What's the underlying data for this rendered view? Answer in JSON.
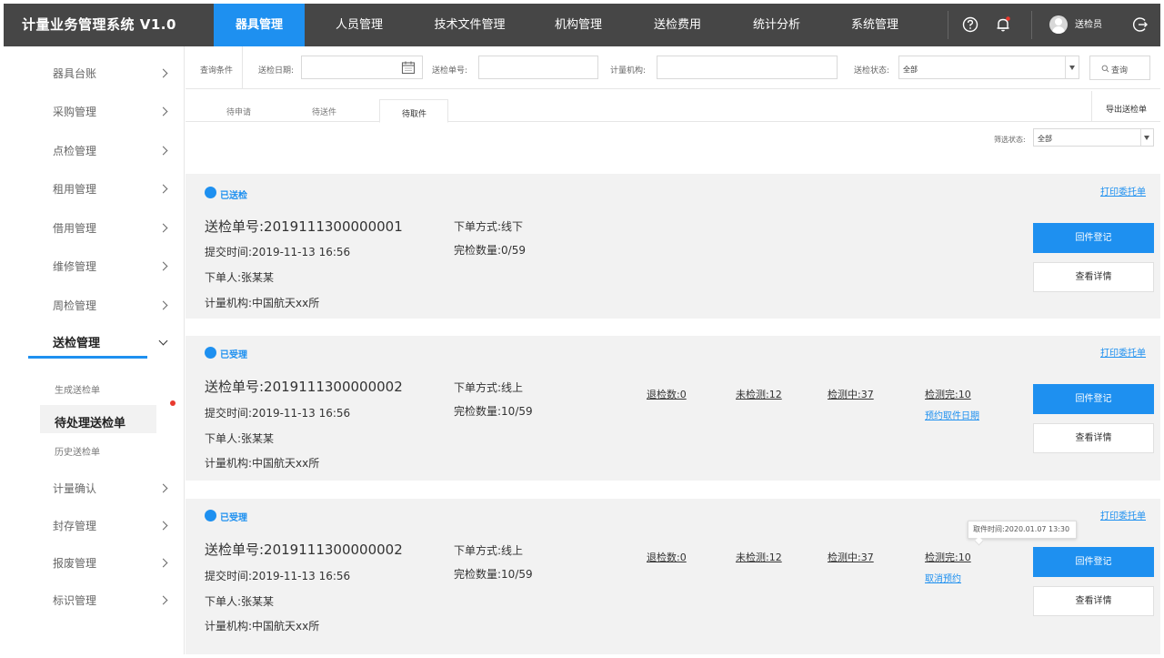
{
  "app": {
    "title": "计量业务管理系统 V1.0",
    "accent_color": "#1e90f0",
    "nav_background": "#464646"
  },
  "topnav": {
    "items": [
      "器具管理",
      "人员管理",
      "技术文件管理",
      "机构管理",
      "送检费用",
      "统计分析",
      "系统管理"
    ],
    "active_index": 0,
    "icons": [
      "help-icon",
      "bell-icon",
      "user-avatar-icon",
      "logout-icon"
    ],
    "user": "送检员"
  },
  "sidebar": {
    "items": [
      "器具台账",
      "采购管理",
      "点检管理",
      "租用管理",
      "借用管理",
      "维修管理",
      "周检管理",
      "送检管理"
    ],
    "items_after": [
      "计量确认",
      "封存管理",
      "报废管理",
      "标识管理"
    ],
    "open_item": "送检管理",
    "submenu": [
      "生成送检单",
      "待处理送检单",
      "历史送检单"
    ],
    "active_sub": "待处理送检单"
  },
  "filters": {
    "section_label": "查询条件",
    "date_label": "送检日期:",
    "order_label": "送检单号:",
    "org_label": "计量机构:",
    "status_label": "送检状态:",
    "status_value": "全部",
    "query_button": "查询"
  },
  "tabs": {
    "items": [
      "待申请",
      "待送件",
      "待取件"
    ],
    "active": "待取件",
    "export_button": "导出送检单",
    "filter_label": "筛选状态:",
    "filter_value": "全部"
  },
  "cards": [
    {
      "status": "已送检",
      "print_link": "打印委托单",
      "order_no": "送检单号:2019111300000001",
      "submit_time": "提交时间:2019-11-13 16:56",
      "creator": "下单人:张某某",
      "org": "计量机构:中国航天xx所",
      "order_method": "下单方式:线下",
      "done_count": "完检数量:0/59",
      "register_button": "回件登记",
      "detail_button": "查看详情"
    },
    {
      "status": "已受理",
      "print_link": "打印委托单",
      "order_no": "送检单号:2019111300000002",
      "submit_time": "提交时间:2019-11-13 16:56",
      "creator": "下单人:张某某",
      "org": "计量机构:中国航天xx所",
      "order_method": "下单方式:线上",
      "done_count": "完检数量:10/59",
      "stats": [
        "退检数:0",
        "未检测:12",
        "检测中:37",
        "检测完:10"
      ],
      "action_link": "预约取件日期",
      "register_button": "回件登记",
      "detail_button": "查看详情"
    },
    {
      "status": "已受理",
      "print_link": "打印委托单",
      "order_no": "送检单号:2019111300000002",
      "submit_time": "提交时间:2019-11-13 16:56",
      "creator": "下单人:张某某",
      "org": "计量机构:中国航天xx所",
      "order_method": "下单方式:线上",
      "done_count": "完检数量:10/59",
      "stats": [
        "退检数:0",
        "未检测:12",
        "检测中:37",
        "检测完:10"
      ],
      "action_link": "取消预约",
      "tooltip": "取件时间:2020.01.07 13:30",
      "register_button": "回件登记",
      "detail_button": "查看详情"
    }
  ]
}
